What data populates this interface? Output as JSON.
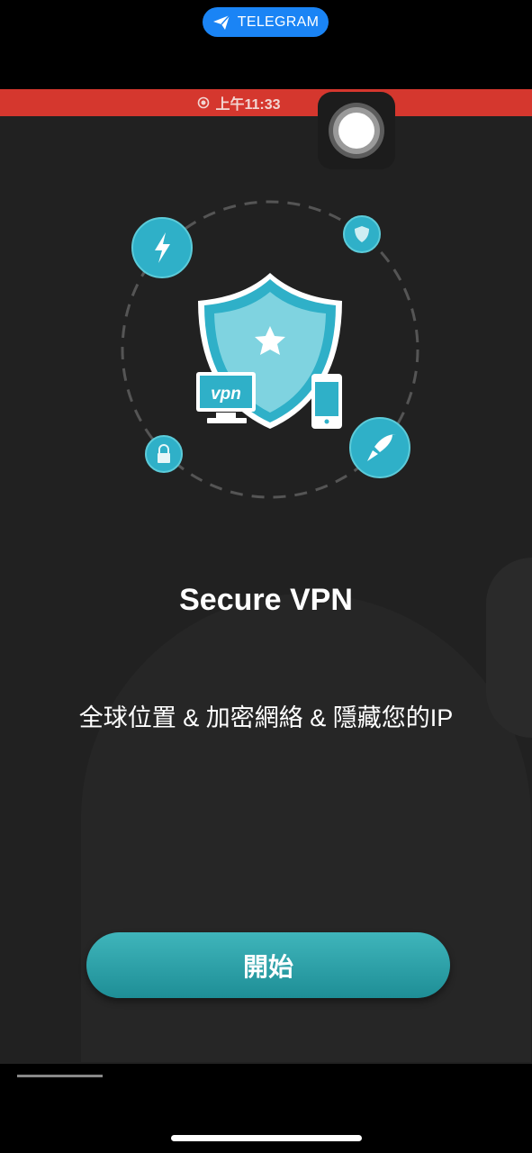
{
  "telegram_pill": {
    "label": "TELEGRAM",
    "icon": "telegram-icon"
  },
  "status": {
    "time": "上午11:33",
    "icon": "recording-icon"
  },
  "app": {
    "title": "Secure VPN",
    "subtitle": "全球位置 & 加密網絡 & 隱藏您的IP",
    "start_label": "開始",
    "vpn_label": "vpn"
  },
  "colors": {
    "accent": "#2fb0c8",
    "button": "#2aa3aa",
    "status_bar": "#d5372e",
    "telegram": "#1a84f5"
  }
}
